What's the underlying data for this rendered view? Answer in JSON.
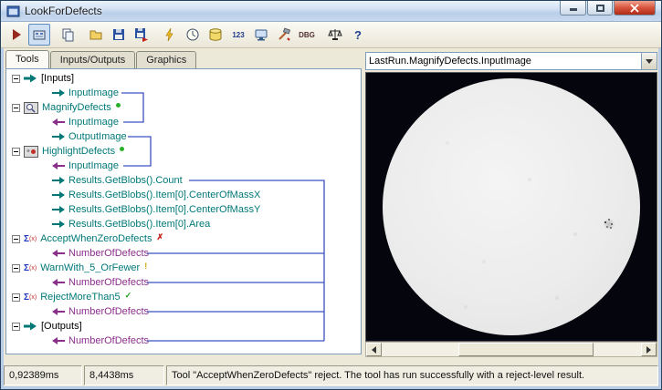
{
  "window": {
    "title": "LookForDefects"
  },
  "toolbar": {
    "buttons": [
      "run",
      "current-image-toggle",
      "copy",
      "open",
      "save",
      "save-image",
      "run-once",
      "timer",
      "database",
      "numeric-display",
      "monitor",
      "tools",
      "debug",
      "profiler",
      "help"
    ],
    "label_123": "123",
    "label_dbg": "DBG",
    "label_help": "?"
  },
  "tabs": [
    {
      "label": "Tools",
      "active": true
    },
    {
      "label": "Inputs/Outputs",
      "active": false
    },
    {
      "label": "Graphics",
      "active": false
    }
  ],
  "tree": {
    "items": [
      {
        "label": "[Inputs]",
        "kind": "input-group"
      },
      {
        "label": "InputImage",
        "kind": "output-terminal"
      },
      {
        "label": "MagnifyDefects",
        "kind": "tool",
        "status": "ran"
      },
      {
        "label": "InputImage",
        "kind": "input-terminal"
      },
      {
        "label": "OutputImage",
        "kind": "output-terminal"
      },
      {
        "label": "HighlightDefects",
        "kind": "tool",
        "status": "ran"
      },
      {
        "label": "InputImage",
        "kind": "input-terminal"
      },
      {
        "label": "Results.GetBlobs().Count",
        "kind": "output-terminal"
      },
      {
        "label": "Results.GetBlobs().Item[0].CenterOfMassX",
        "kind": "output-terminal"
      },
      {
        "label": "Results.GetBlobs().Item[0].CenterOfMassY",
        "kind": "output-terminal"
      },
      {
        "label": "Results.GetBlobs().Item[0].Area",
        "kind": "output-terminal"
      },
      {
        "label": "AcceptWhenZeroDefects",
        "kind": "tool",
        "status": "reject"
      },
      {
        "label": "NumberOfDefects",
        "kind": "input-terminal"
      },
      {
        "label": "WarnWith_5_OrFewer",
        "kind": "tool",
        "status": "warn"
      },
      {
        "label": "NumberOfDefects",
        "kind": "input-terminal"
      },
      {
        "label": "RejectMoreThan5",
        "kind": "tool",
        "status": "accept"
      },
      {
        "label": "NumberOfDefects",
        "kind": "input-terminal"
      },
      {
        "label": "[Outputs]",
        "kind": "output-group"
      },
      {
        "label": "NumberOfDefects",
        "kind": "input-terminal"
      }
    ]
  },
  "glyphs": {
    "sigma": "Σ",
    "sigma_args": "(x)",
    "check": "✓",
    "cross": "✗",
    "warn": "!"
  },
  "viewer": {
    "source": "LastRun.MagnifyDefects.InputImage"
  },
  "statusbar": {
    "time1": "0,92389ms",
    "time2": "8,4438ms",
    "message": "Tool \"AcceptWhenZeroDefects\" reject. The tool has run successfully with a reject-level result."
  },
  "colors": {
    "tool_name": "#007878",
    "output_terminal": "#007878",
    "input_terminal_value": "#8b2e8b",
    "wire": "#3b52c0",
    "accept_green": "#1fa01f",
    "warn_yellow": "#cfa200",
    "reject_red": "#c22018"
  }
}
